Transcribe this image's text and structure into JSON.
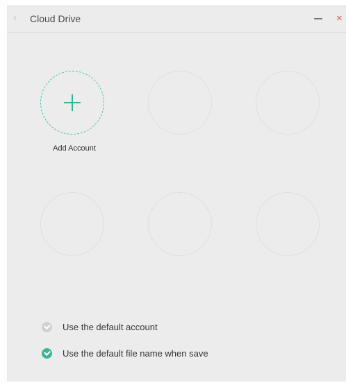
{
  "window": {
    "title": "Cloud Drive",
    "back_glyph": "‹",
    "close_glyph": "×"
  },
  "accounts": {
    "add_label": "Add Account"
  },
  "options": [
    {
      "label": "Use the default account",
      "checked": false
    },
    {
      "label": "Use the default file name when save",
      "checked": true
    }
  ],
  "colors": {
    "accent": "#3ab597",
    "close": "#e05555",
    "background": "#ececec"
  }
}
